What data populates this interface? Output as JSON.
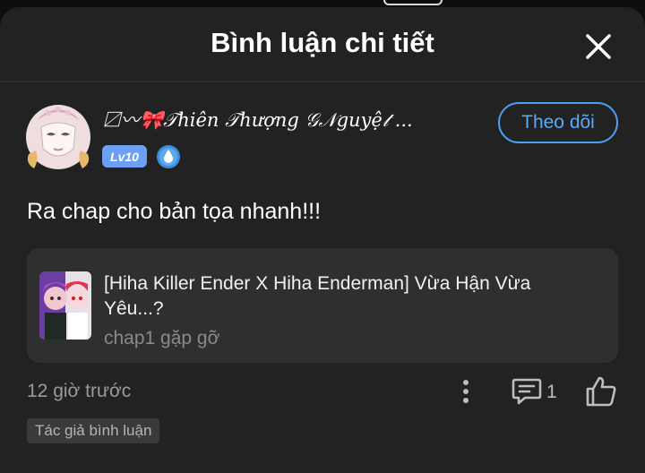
{
  "sheet": {
    "title": "Bình luận chi tiết"
  },
  "comment": {
    "username": "〼〰🎀𝒯hiên 𝒯hượng 𝒢𝒩guyệ𝓉 ...",
    "level": "Lv10",
    "follow_label": "Theo dõi",
    "text": "Ra chap cho bản tọa nhanh!!!",
    "time": "12 giờ trước",
    "reply_count": "1",
    "author_tag": "Tác giả bình luận"
  },
  "manga": {
    "title": "[Hiha Killer Ender X Hiha Enderman] Vừa Hận Vừa Yêu...?",
    "chapter": "chap1 gặp gỡ"
  },
  "icons": {
    "close": "close-icon",
    "more": "more-vertical-icon",
    "reply": "comment-icon",
    "like": "thumbs-up-icon",
    "rank": "rank-drop-icon"
  },
  "colors": {
    "sheet_bg": "#222222",
    "accent": "#4b9ef1",
    "level_badge": "#6d9ff5"
  }
}
